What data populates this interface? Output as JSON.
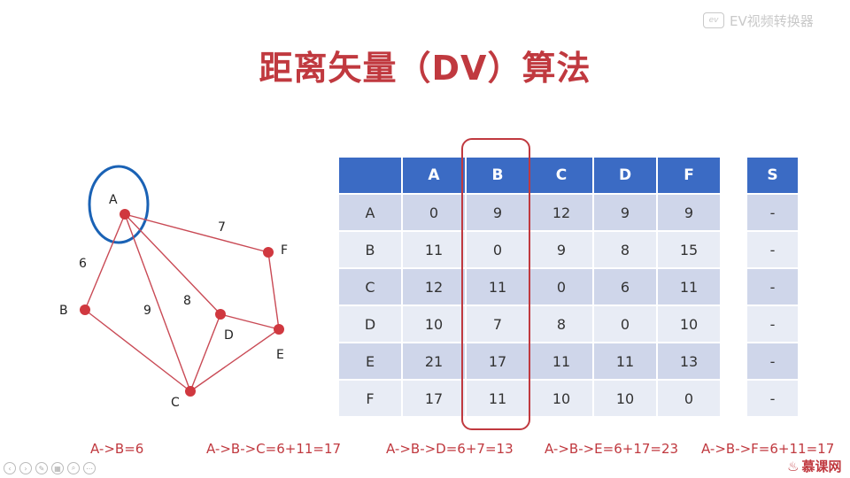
{
  "watermark": {
    "badge": "ev",
    "text": "EV视频转换器"
  },
  "title": "距离矢量（DV）算法",
  "graph": {
    "nodes": [
      {
        "id": "A",
        "label": "A"
      },
      {
        "id": "B",
        "label": "B"
      },
      {
        "id": "C",
        "label": "C"
      },
      {
        "id": "D",
        "label": "D"
      },
      {
        "id": "E",
        "label": "E"
      },
      {
        "id": "F",
        "label": "F"
      }
    ],
    "edge_weights": {
      "AB": "6",
      "AF": "7",
      "AC": "9",
      "AD": "8"
    }
  },
  "table": {
    "headers": [
      "",
      "A",
      "B",
      "C",
      "D",
      "F"
    ],
    "rows": [
      [
        "A",
        "0",
        "9",
        "12",
        "9",
        "9"
      ],
      [
        "B",
        "11",
        "0",
        "9",
        "8",
        "15"
      ],
      [
        "C",
        "12",
        "11",
        "0",
        "6",
        "11"
      ],
      [
        "D",
        "10",
        "7",
        "8",
        "0",
        "10"
      ],
      [
        "E",
        "21",
        "17",
        "11",
        "11",
        "13"
      ],
      [
        "F",
        "17",
        "11",
        "10",
        "10",
        "0"
      ]
    ]
  },
  "s_table": {
    "header": "S",
    "values": [
      "-",
      "-",
      "-",
      "-",
      "-",
      "-"
    ]
  },
  "calcs": [
    "A->B=6",
    "A->B->C=6+11=17",
    "A->B->D=6+7=13",
    "A->B->E=6+17=23",
    "A->B->F=6+11=17"
  ],
  "logo": {
    "text": "慕课网"
  },
  "colors": {
    "accent": "#c0393f",
    "header": "#3b6bc4",
    "row_dark": "#cfd6ea",
    "row_light": "#e8ecf5",
    "circle": "#1a62b5"
  }
}
